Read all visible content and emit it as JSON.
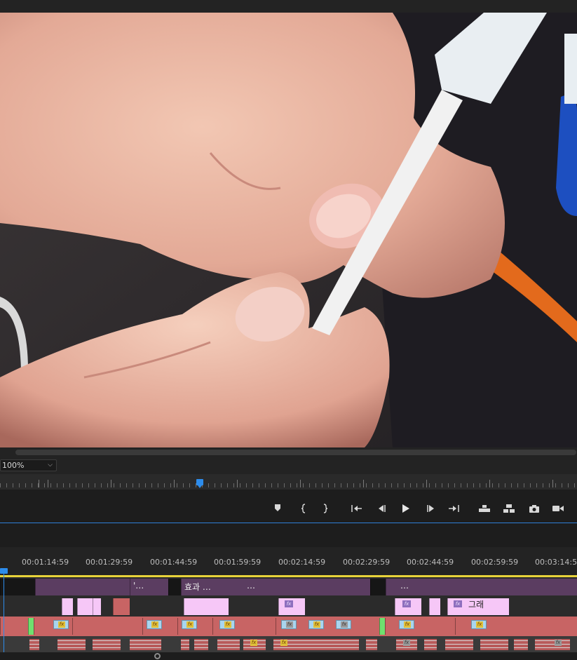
{
  "monitor": {
    "zoom": "100%",
    "playhead_position_fraction": 0.35
  },
  "transport": {
    "buttons": [
      "add-marker",
      "mark-in",
      "mark-out",
      "go-to-in",
      "step-back",
      "play",
      "step-forward",
      "go-to-out",
      "lift",
      "extract",
      "export-frame",
      "button-editor"
    ]
  },
  "timeline": {
    "ruler_labels": [
      "00:01:14:59",
      "00:01:29:59",
      "00:01:44:59",
      "00:01:59:59",
      "00:02:14:59",
      "00:02:29:59",
      "00:02:44:59",
      "00:02:59:59",
      "00:03:14:59"
    ],
    "clips": {
      "c1": "'…",
      "c2": "효과 …",
      "c3": "…",
      "c4": "…",
      "c5": "그래"
    },
    "fx_label": "fx"
  },
  "colors": {
    "playhead": "#2d8ceb",
    "work_area": "#e8d33a",
    "title_track": "#5b3d61",
    "graphic_clip": "#f6c7f7",
    "video_clip": "#c86464"
  }
}
